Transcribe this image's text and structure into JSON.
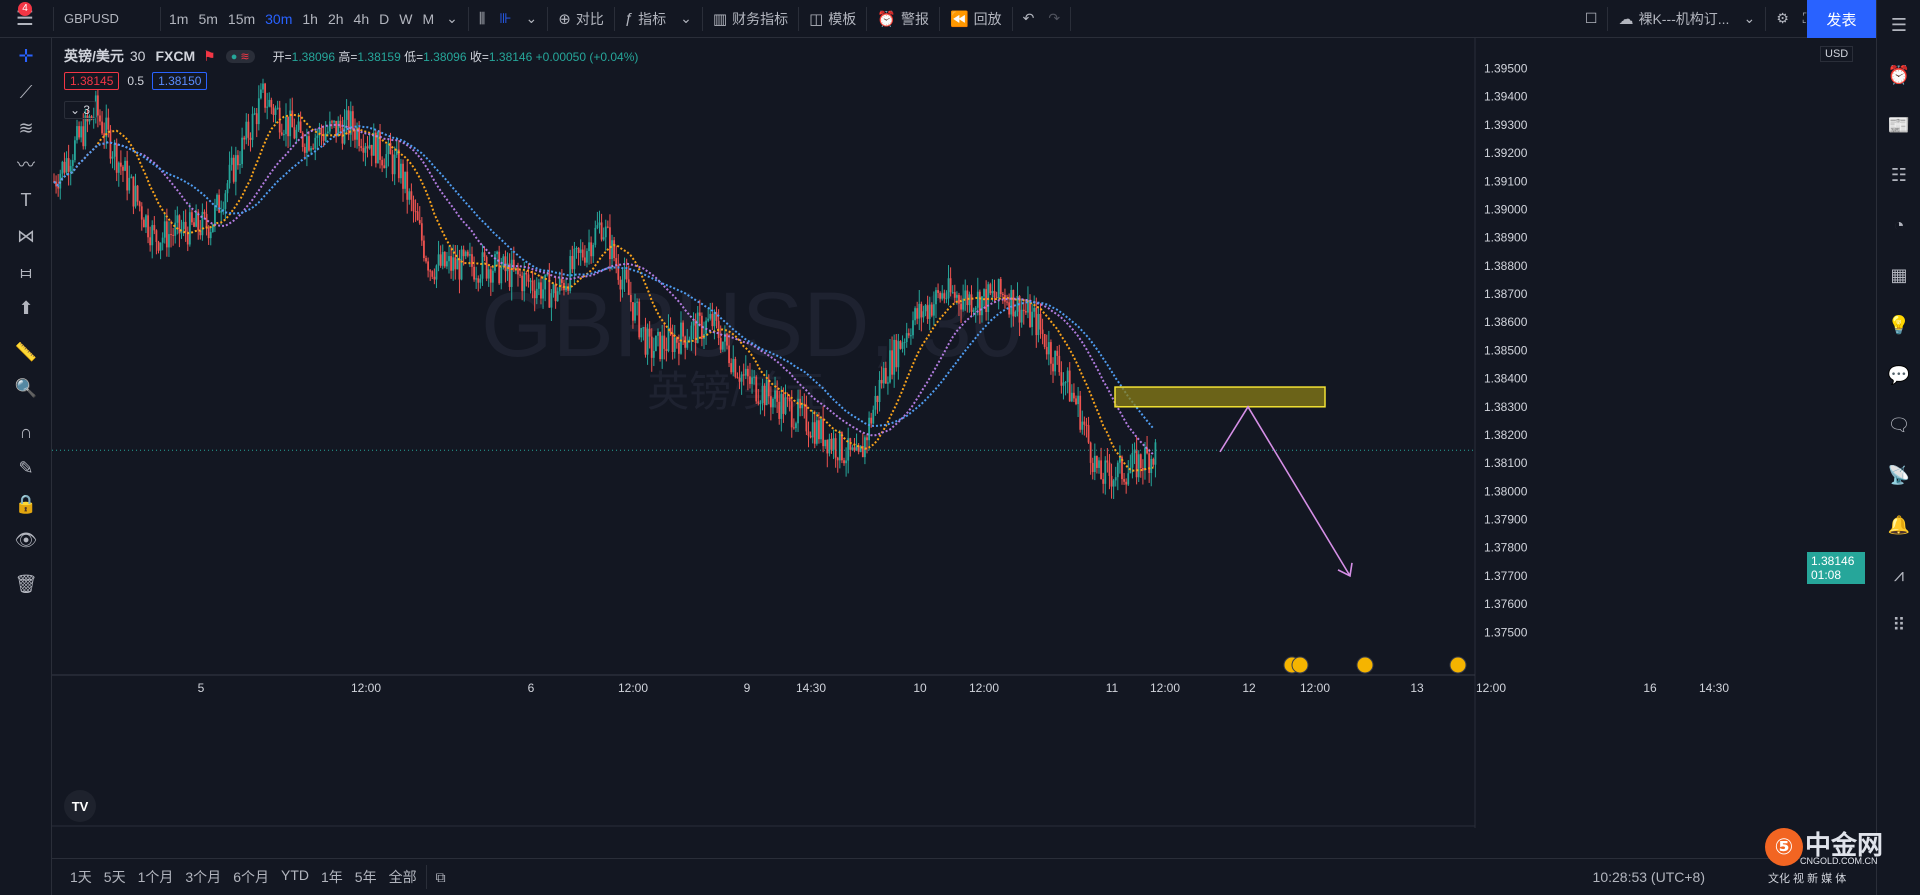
{
  "toolbar": {
    "notif_count": "4",
    "symbol": "GBPUSD",
    "intervals": [
      "1m",
      "5m",
      "15m",
      "30m",
      "1h",
      "2h",
      "4h",
      "D",
      "W",
      "M"
    ],
    "active_interval": "30m",
    "compare": "对比",
    "indicators": "指标",
    "financials": "财务指标",
    "templates": "模板",
    "alert": "警报",
    "replay": "回放",
    "layout_name": "裸K---机构订...",
    "publish": "发表"
  },
  "legend": {
    "title": "英镑/美元",
    "interval": "30",
    "source": "FXCM",
    "open_label": "开=",
    "open": "1.38096",
    "high_label": "高=",
    "high": "1.38159",
    "low_label": "低=",
    "low": "1.38096",
    "close_label": "收=",
    "close": "1.38146",
    "change": "+0.00050 (+0.04%)",
    "bid": "1.38145",
    "spread": "0.5",
    "ask": "1.38150",
    "indicator_count": "3"
  },
  "watermark": {
    "symbol": "GBPUSD, 30",
    "name": "英镑/美元"
  },
  "price_axis": {
    "currency": "USD",
    "current_price": "1.38146",
    "countdown": "01:08"
  },
  "time_axis": [
    "12:00",
    "5",
    "12:00",
    "6",
    "12:00",
    "9",
    "14:30",
    "10",
    "12:00",
    "11",
    "12:00",
    "12",
    "12:00",
    "13",
    "12:00",
    "16",
    "14:30"
  ],
  "bottom": {
    "ranges": [
      "1天",
      "5天",
      "1个月",
      "3个月",
      "6个月",
      "YTD",
      "1年",
      "5年",
      "全部"
    ],
    "clock": "10:28:53 (UTC+8)",
    "site_name": "中金网",
    "site_url": "CNGOLD.COM.CN",
    "site_tabs": "文化 视 新 媒 体"
  },
  "colors": {
    "up": "#26a69a",
    "down": "#ef5350",
    "ma_fast": "#f7a21b",
    "ma_mid": "#b27ce0",
    "ma_slow": "#4f9cf0",
    "zone_fill": "#8a7d15",
    "zone_border": "#f2e234",
    "arrow": "#d58fe6"
  },
  "chart_data": {
    "type": "candlestick",
    "symbol": "GBPUSD",
    "timeframe": "30",
    "ylim": [
      1.3743,
      1.3958
    ],
    "y_ticks": [
      1.395,
      1.394,
      1.393,
      1.392,
      1.391,
      1.39,
      1.389,
      1.388,
      1.387,
      1.386,
      1.385,
      1.384,
      1.383,
      1.382,
      1.381,
      1.38,
      1.379,
      1.378,
      1.377,
      1.376,
      1.375
    ],
    "key_points": [
      {
        "t": 0,
        "p": 1.391
      },
      {
        "t": 20,
        "p": 1.3935
      },
      {
        "t": 48,
        "p": 1.389
      },
      {
        "t": 75,
        "p": 1.3895
      },
      {
        "t": 100,
        "p": 1.394
      },
      {
        "t": 118,
        "p": 1.3925
      },
      {
        "t": 142,
        "p": 1.393
      },
      {
        "t": 165,
        "p": 1.3915
      },
      {
        "t": 180,
        "p": 1.388
      },
      {
        "t": 210,
        "p": 1.388
      },
      {
        "t": 240,
        "p": 1.387
      },
      {
        "t": 262,
        "p": 1.3895
      },
      {
        "t": 285,
        "p": 1.385
      },
      {
        "t": 315,
        "p": 1.386
      },
      {
        "t": 330,
        "p": 1.384
      },
      {
        "t": 360,
        "p": 1.3825
      },
      {
        "t": 385,
        "p": 1.381
      },
      {
        "t": 396,
        "p": 1.384
      },
      {
        "t": 410,
        "p": 1.386
      },
      {
        "t": 425,
        "p": 1.387
      },
      {
        "t": 445,
        "p": 1.3868
      },
      {
        "t": 455,
        "p": 1.387
      },
      {
        "t": 470,
        "p": 1.386
      },
      {
        "t": 490,
        "p": 1.383
      },
      {
        "t": 500,
        "p": 1.3805
      },
      {
        "t": 515,
        "p": 1.3808
      },
      {
        "t": 527,
        "p": 1.3814
      }
    ],
    "zone": {
      "price_top": 1.3837,
      "price_bottom": 1.383
    },
    "projection": [
      {
        "t": 527,
        "p": 1.3814
      },
      {
        "t": 538,
        "p": 1.383
      },
      {
        "t": 583,
        "p": 1.377
      }
    ]
  }
}
